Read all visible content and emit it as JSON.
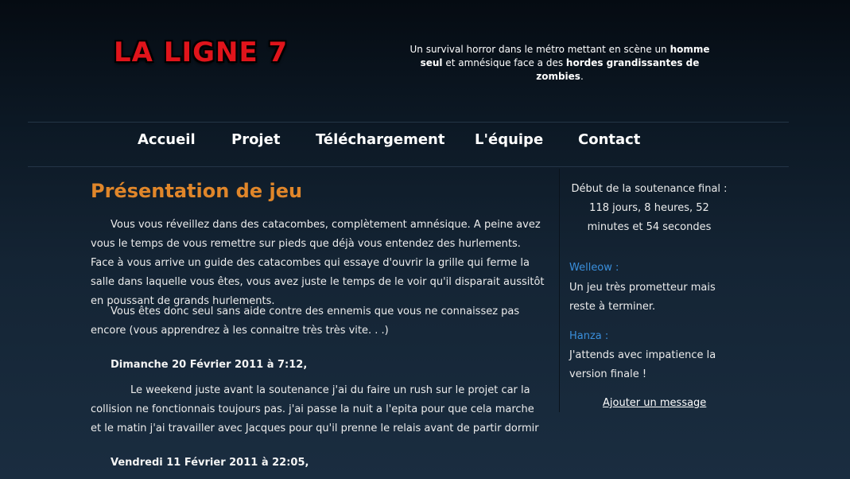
{
  "header": {
    "logo_text": "LA LIGNE 7",
    "tagline_part1": "Un survival horror dans le métro mettant en scène un ",
    "tagline_bold1": "homme seul",
    "tagline_part2": " et amnésique face a des ",
    "tagline_bold2": "hordes grandissantes de zombies",
    "tagline_part3": "."
  },
  "nav": {
    "items": [
      {
        "label": "Accueil"
      },
      {
        "label": "Projet"
      },
      {
        "label": "Téléchargement"
      },
      {
        "label": "L'équipe"
      },
      {
        "label": "Contact"
      }
    ]
  },
  "main": {
    "title": "Présentation de jeu",
    "paragraph1": "Vous vous réveillez dans des catacombes, complètement amnésique. A peine avez vous le temps de vous remettre sur pieds que déjà vous entendez des hurlements. Face à vous arrive un guide des catacombes qui essaye d'ouvrir la grille qui ferme la salle dans laquelle vous êtes, vous avez juste le temps de le voir qu'il disparait aussitôt en poussant de grands hurlements.",
    "paragraph2": "Vous êtes donc seul sans aide contre des ennemis que vous ne connaissez pas encore (vous apprendrez à les connaitre très très vite. . .)",
    "news": [
      {
        "date": "Dimanche 20 Février 2011 à 7:12,",
        "text": "Le weekend juste avant la soutenance j'ai du faire un rush sur le projet car la collision ne fonctionnais toujours pas. j'ai passe la nuit a l'epita pour que cela marche et le matin j'ai travailler avec Jacques pour qu'il prenne le relais avant de partir dormir"
      },
      {
        "date": "Vendredi 11 Février 2011 à 22:05,"
      }
    ]
  },
  "sidebar": {
    "countdown_label": "Début de la soutenance final :",
    "countdown_value": "118 jours, 8 heures, 52 minutes et 54 secondes",
    "comments": [
      {
        "author": "Welleow :",
        "text": "Un jeu très prometteur mais reste à terminer."
      },
      {
        "author": "Hanza :",
        "text": "J'attends avec impatience la version finale !"
      }
    ],
    "add_message": "Ajouter un message"
  }
}
